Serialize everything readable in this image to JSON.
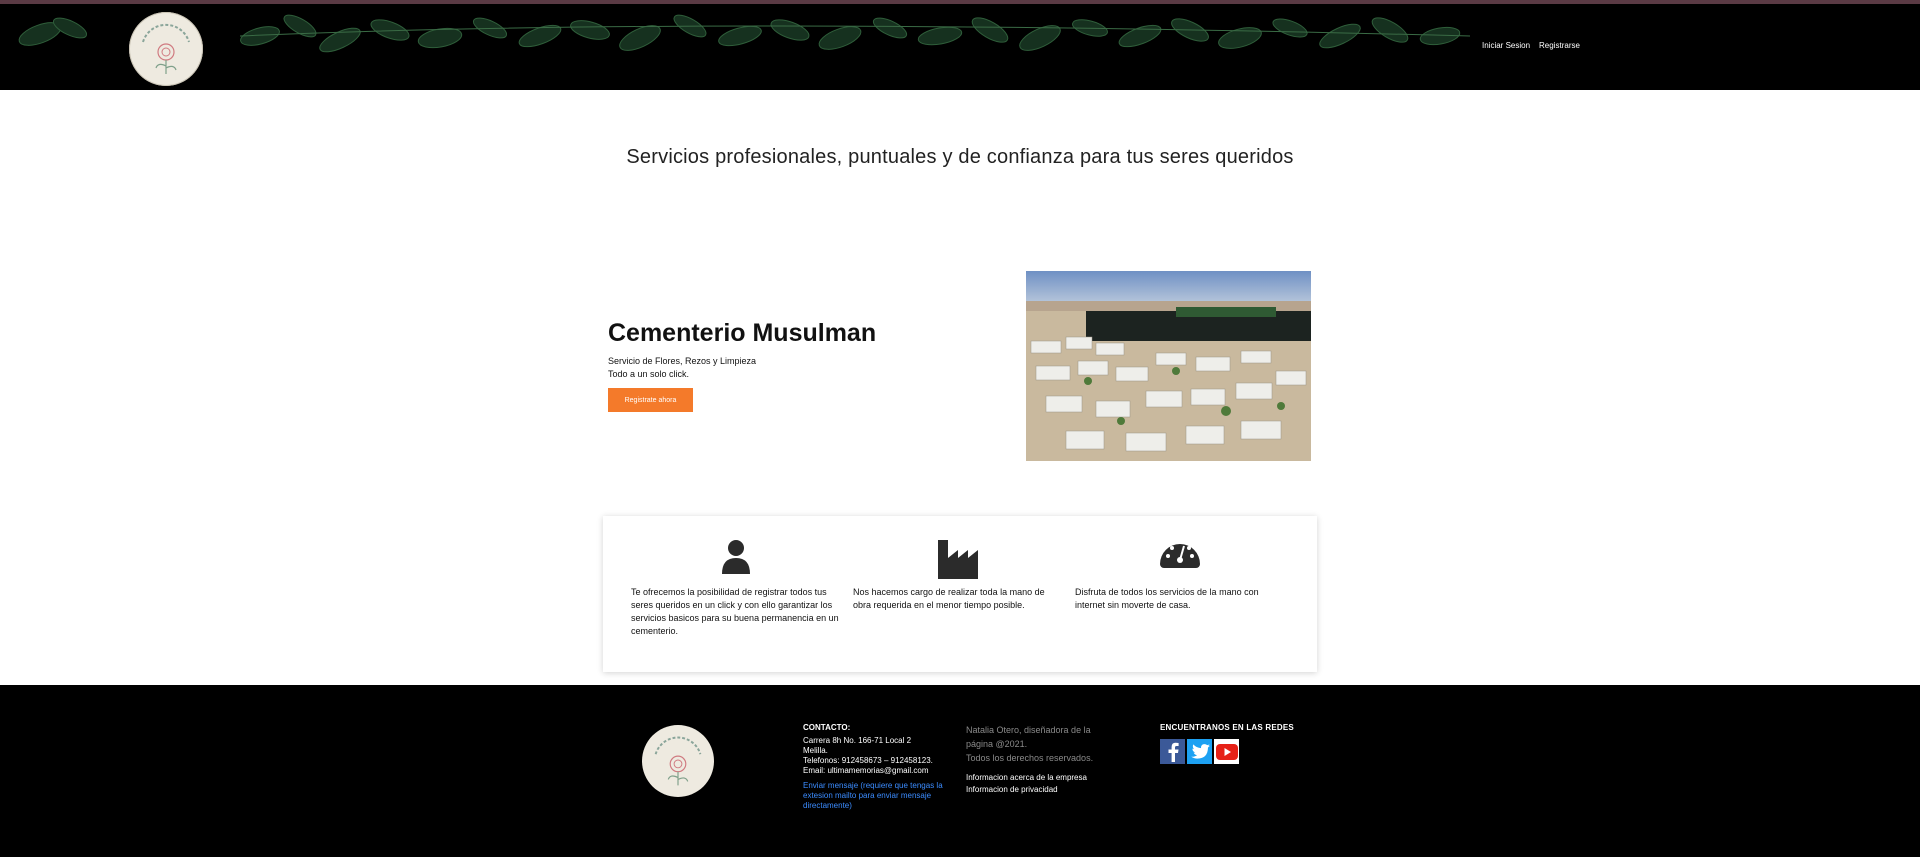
{
  "header": {
    "nav": {
      "login": "Iniciar Sesion",
      "register": "Registrarse"
    }
  },
  "hero": {
    "tagline": "Servicios profesionales, puntuales y de confianza para tus seres queridos"
  },
  "feature": {
    "title": "Cementerio Musulman",
    "subtitle_line1": "Servicio de Flores, Rezos y Limpieza",
    "subtitle_line2": "Todo a un solo click.",
    "cta": "Registrate ahora"
  },
  "cards": [
    {
      "icon": "user-icon",
      "text": "Te ofrecemos la posibilidad de registrar todos tus seres queridos en un click y con ello garantizar los servicios basicos para su buena permanencia en un cementerio."
    },
    {
      "icon": "factory-icon",
      "text": "Nos hacemos cargo de realizar toda la mano de obra requerida en el menor tiempo posible."
    },
    {
      "icon": "speedometer-icon",
      "text": "Disfruta de todos los servicios de la mano con internet sin moverte de casa."
    }
  ],
  "footer": {
    "contact_heading": "CONTACTO:",
    "address_line1": "Carrera 8h No. 166-71 Local 2",
    "address_line2": "Melilla.",
    "phones": "Telefonos: 912458673 – 912458123.",
    "email": "Email: ultimamemorias@gmail.com",
    "send_message": "Enviar mensaje (requiere que tengas la extesion mailto para enviar mensaje directamente)",
    "credits_line1": "Natalia Otero, diseñadora de la página @2021.",
    "credits_line2": "Todos los derechos reservados.",
    "about_link": "Informacion acerca de la empresa",
    "privacy_link": "Informacion de privacidad",
    "social_heading": "ENCUENTRANOS EN LAS REDES"
  },
  "colors": {
    "accent": "#f47a2a",
    "header_bg": "#000000",
    "link": "#3b8cff",
    "facebook": "#3b5998",
    "twitter": "#1da1f2",
    "youtube": "#e62117"
  }
}
